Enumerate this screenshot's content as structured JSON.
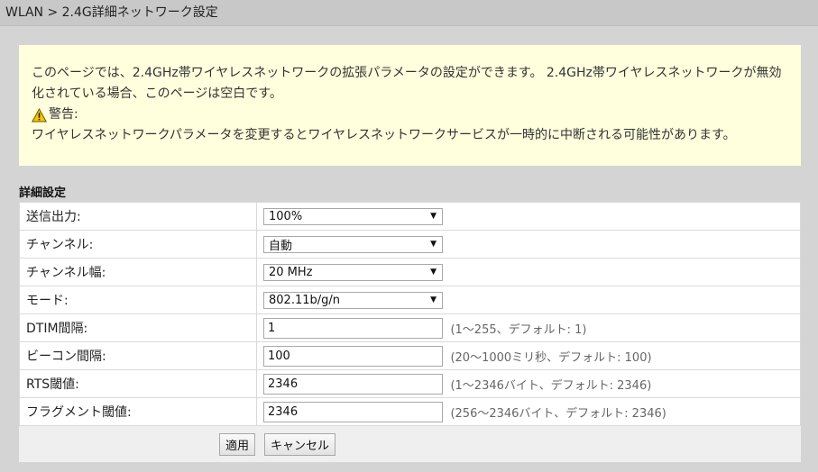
{
  "header": {
    "breadcrumb": "WLAN > 2.4G詳細ネットワーク設定"
  },
  "notice": {
    "text": "このページでは、2.4GHz帯ワイヤレスネットワークの拡張パラメータの設定ができます。 2.4GHz帯ワイヤレスネットワークが無効化されている場合、このページは空白です。",
    "warning_label": "警告:",
    "warning_text": "ワイヤレスネットワークパラメータを変更するとワイヤレスネットワークサービスが一時的に中断される可能性があります。"
  },
  "section": {
    "title": "詳細設定"
  },
  "rows": [
    {
      "label": "送信出力:",
      "type": "select",
      "value": "100%"
    },
    {
      "label": "チャンネル:",
      "type": "select",
      "value": "自動"
    },
    {
      "label": "チャンネル幅:",
      "type": "select",
      "value": "20 MHz"
    },
    {
      "label": "モード:",
      "type": "select",
      "value": "802.11b/g/n"
    },
    {
      "label": "DTIM間隔:",
      "type": "input",
      "value": "1",
      "hint": "(1～255、デフォルト: 1)"
    },
    {
      "label": "ビーコン間隔:",
      "type": "input",
      "value": "100",
      "hint": "(20～1000ミリ秒、デフォルト: 100)"
    },
    {
      "label": "RTS閾値:",
      "type": "input",
      "value": "2346",
      "hint": "(1～2346バイト、デフォルト: 2346)"
    },
    {
      "label": "フラグメント閾値:",
      "type": "input",
      "value": "2346",
      "hint": "(256～2346バイト、デフォルト: 2346)"
    }
  ],
  "buttons": {
    "apply": "適用",
    "cancel": "キャンセル"
  },
  "colors": {
    "notice_bg": "#ffffdd",
    "page_bg": "#d4d4d4",
    "warning_icon": "#f5c400"
  }
}
